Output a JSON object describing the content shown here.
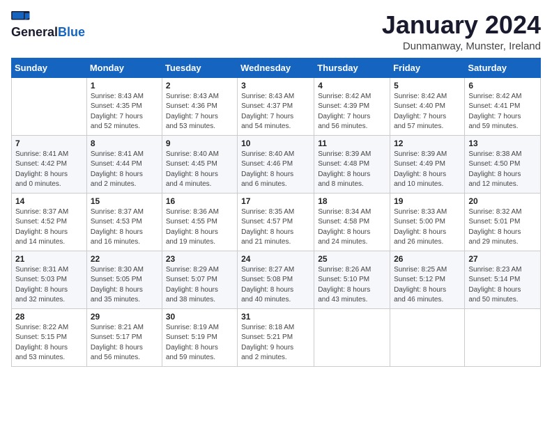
{
  "header": {
    "logo_general": "General",
    "logo_blue": "Blue",
    "title": "January 2024",
    "location": "Dunmanway, Munster, Ireland"
  },
  "weekdays": [
    "Sunday",
    "Monday",
    "Tuesday",
    "Wednesday",
    "Thursday",
    "Friday",
    "Saturday"
  ],
  "weeks": [
    [
      {
        "day": "",
        "info": ""
      },
      {
        "day": "1",
        "info": "Sunrise: 8:43 AM\nSunset: 4:35 PM\nDaylight: 7 hours\nand 52 minutes."
      },
      {
        "day": "2",
        "info": "Sunrise: 8:43 AM\nSunset: 4:36 PM\nDaylight: 7 hours\nand 53 minutes."
      },
      {
        "day": "3",
        "info": "Sunrise: 8:43 AM\nSunset: 4:37 PM\nDaylight: 7 hours\nand 54 minutes."
      },
      {
        "day": "4",
        "info": "Sunrise: 8:42 AM\nSunset: 4:39 PM\nDaylight: 7 hours\nand 56 minutes."
      },
      {
        "day": "5",
        "info": "Sunrise: 8:42 AM\nSunset: 4:40 PM\nDaylight: 7 hours\nand 57 minutes."
      },
      {
        "day": "6",
        "info": "Sunrise: 8:42 AM\nSunset: 4:41 PM\nDaylight: 7 hours\nand 59 minutes."
      }
    ],
    [
      {
        "day": "7",
        "info": "Sunrise: 8:41 AM\nSunset: 4:42 PM\nDaylight: 8 hours\nand 0 minutes."
      },
      {
        "day": "8",
        "info": "Sunrise: 8:41 AM\nSunset: 4:44 PM\nDaylight: 8 hours\nand 2 minutes."
      },
      {
        "day": "9",
        "info": "Sunrise: 8:40 AM\nSunset: 4:45 PM\nDaylight: 8 hours\nand 4 minutes."
      },
      {
        "day": "10",
        "info": "Sunrise: 8:40 AM\nSunset: 4:46 PM\nDaylight: 8 hours\nand 6 minutes."
      },
      {
        "day": "11",
        "info": "Sunrise: 8:39 AM\nSunset: 4:48 PM\nDaylight: 8 hours\nand 8 minutes."
      },
      {
        "day": "12",
        "info": "Sunrise: 8:39 AM\nSunset: 4:49 PM\nDaylight: 8 hours\nand 10 minutes."
      },
      {
        "day": "13",
        "info": "Sunrise: 8:38 AM\nSunset: 4:50 PM\nDaylight: 8 hours\nand 12 minutes."
      }
    ],
    [
      {
        "day": "14",
        "info": "Sunrise: 8:37 AM\nSunset: 4:52 PM\nDaylight: 8 hours\nand 14 minutes."
      },
      {
        "day": "15",
        "info": "Sunrise: 8:37 AM\nSunset: 4:53 PM\nDaylight: 8 hours\nand 16 minutes."
      },
      {
        "day": "16",
        "info": "Sunrise: 8:36 AM\nSunset: 4:55 PM\nDaylight: 8 hours\nand 19 minutes."
      },
      {
        "day": "17",
        "info": "Sunrise: 8:35 AM\nSunset: 4:57 PM\nDaylight: 8 hours\nand 21 minutes."
      },
      {
        "day": "18",
        "info": "Sunrise: 8:34 AM\nSunset: 4:58 PM\nDaylight: 8 hours\nand 24 minutes."
      },
      {
        "day": "19",
        "info": "Sunrise: 8:33 AM\nSunset: 5:00 PM\nDaylight: 8 hours\nand 26 minutes."
      },
      {
        "day": "20",
        "info": "Sunrise: 8:32 AM\nSunset: 5:01 PM\nDaylight: 8 hours\nand 29 minutes."
      }
    ],
    [
      {
        "day": "21",
        "info": "Sunrise: 8:31 AM\nSunset: 5:03 PM\nDaylight: 8 hours\nand 32 minutes."
      },
      {
        "day": "22",
        "info": "Sunrise: 8:30 AM\nSunset: 5:05 PM\nDaylight: 8 hours\nand 35 minutes."
      },
      {
        "day": "23",
        "info": "Sunrise: 8:29 AM\nSunset: 5:07 PM\nDaylight: 8 hours\nand 38 minutes."
      },
      {
        "day": "24",
        "info": "Sunrise: 8:27 AM\nSunset: 5:08 PM\nDaylight: 8 hours\nand 40 minutes."
      },
      {
        "day": "25",
        "info": "Sunrise: 8:26 AM\nSunset: 5:10 PM\nDaylight: 8 hours\nand 43 minutes."
      },
      {
        "day": "26",
        "info": "Sunrise: 8:25 AM\nSunset: 5:12 PM\nDaylight: 8 hours\nand 46 minutes."
      },
      {
        "day": "27",
        "info": "Sunrise: 8:23 AM\nSunset: 5:14 PM\nDaylight: 8 hours\nand 50 minutes."
      }
    ],
    [
      {
        "day": "28",
        "info": "Sunrise: 8:22 AM\nSunset: 5:15 PM\nDaylight: 8 hours\nand 53 minutes."
      },
      {
        "day": "29",
        "info": "Sunrise: 8:21 AM\nSunset: 5:17 PM\nDaylight: 8 hours\nand 56 minutes."
      },
      {
        "day": "30",
        "info": "Sunrise: 8:19 AM\nSunset: 5:19 PM\nDaylight: 8 hours\nand 59 minutes."
      },
      {
        "day": "31",
        "info": "Sunrise: 8:18 AM\nSunset: 5:21 PM\nDaylight: 9 hours\nand 2 minutes."
      },
      {
        "day": "",
        "info": ""
      },
      {
        "day": "",
        "info": ""
      },
      {
        "day": "",
        "info": ""
      }
    ]
  ]
}
